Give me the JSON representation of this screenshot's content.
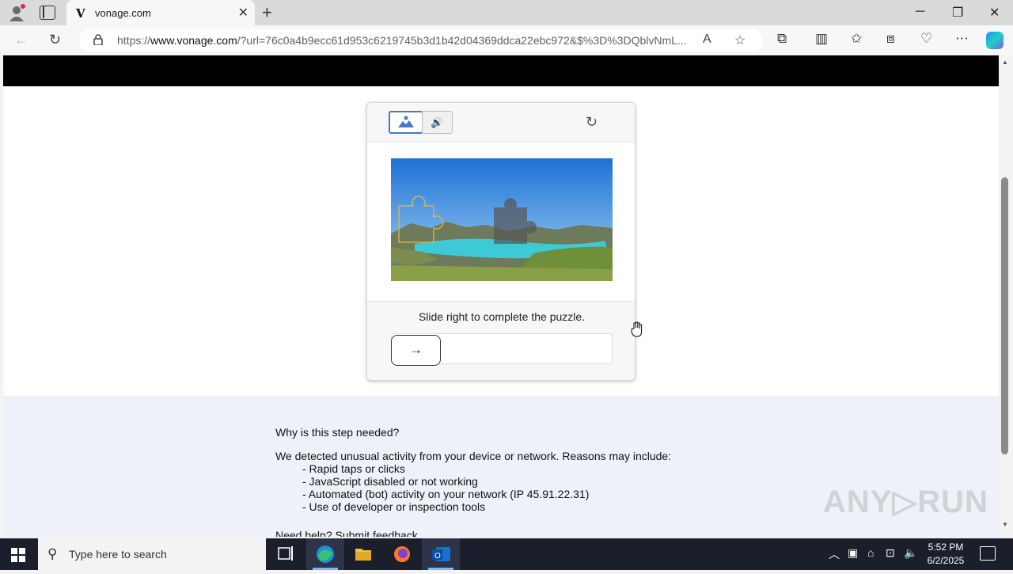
{
  "browser": {
    "tab_title": "vonage.com",
    "tab_favicon": "V",
    "url_host_prefix": "https://",
    "url_host": "www.vonage.com",
    "url_rest": "/?url=76c0a4b9ecc61d953c6219745b3d1b42d04369ddca22ebc972&$%3D%3DQblvNmL..."
  },
  "captcha": {
    "instruction": "Slide right to complete the puzzle.",
    "slider_arrow": "→",
    "refresh_icon": "↻",
    "audio_icon": "🔊"
  },
  "info": {
    "heading": "Why is this step needed?",
    "intro": "We detected unusual activity from your device or network. Reasons may include:",
    "reasons": [
      "- Rapid taps or clicks",
      "- JavaScript disabled or not working",
      "- Automated (bot) activity on your network (IP 45.91.22.31)",
      "- Use of developer or inspection tools"
    ],
    "help_text": "Need help?",
    "help_link": "Submit feedback."
  },
  "watermark": "ANY▷RUN",
  "taskbar": {
    "search_placeholder": "Type here to search",
    "time": "5:52 PM",
    "date": "6/2/2025"
  },
  "colors": {
    "accent": "#4a78c2",
    "info_bg": "#eef1f9",
    "taskbar_bg": "#1b1f2c"
  }
}
